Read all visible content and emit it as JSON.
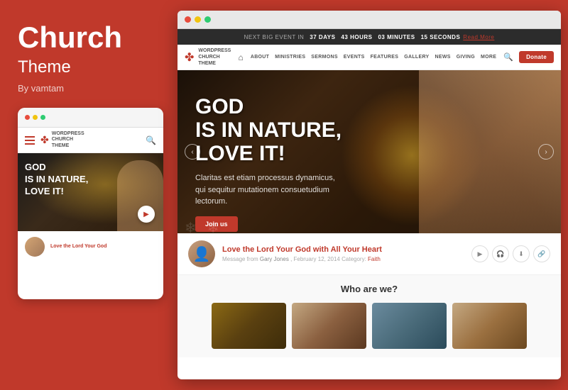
{
  "left_panel": {
    "title": "Church",
    "subtitle": "Theme",
    "author": "By vamtam"
  },
  "mobile_mockup": {
    "dots": [
      "red",
      "yellow",
      "green"
    ],
    "logo_text": "WORDPRESS\nCHURCH\nTHEME",
    "hero_text": "GOD\nIS IN NATURE,\nLOVE IT!",
    "sermon_title": "Love the Lord Your God"
  },
  "browser": {
    "dots": [
      "red",
      "yellow",
      "green"
    ],
    "announcement": {
      "label": "NEXT BIG EVENT IN",
      "days_label": "DAYS",
      "days_value": "37",
      "hours_label": "HOURS",
      "hours_value": "43",
      "minutes_label": "MINUTES",
      "minutes_value": "03",
      "seconds_label": "SECONDS",
      "seconds_value": "15",
      "read_more": "Read More"
    },
    "nav": {
      "logo_text": "WORDPRESS\nCHURCH\nTHEME",
      "links": [
        "ABOUT",
        "MINISTRIES",
        "SERMONS",
        "EVENTS",
        "FEATURES",
        "GALLERY",
        "NEWS",
        "GIVING",
        "MORE"
      ],
      "donate_label": "Donate"
    },
    "hero": {
      "title": "GOD\nIS IN NATURE,\nLOVE IT!",
      "subtitle": "Claritas est etiam processus dynamicus,\nqui sequitur mutationem consuetudium lectorum.",
      "cta_label": "Join us"
    },
    "sermon": {
      "title": "Love the Lord Your God with All Your Heart",
      "meta_prefix": "Message from",
      "author": "Gary Jones",
      "date": "February 12, 2014",
      "category_prefix": "Category:",
      "category": "Faith",
      "icons": [
        "play",
        "headphones",
        "download",
        "link"
      ]
    },
    "who": {
      "title": "Who are we?"
    }
  },
  "colors": {
    "brand": "#c0392b",
    "dark": "#2c2c2c",
    "light": "#f9f9f9"
  }
}
